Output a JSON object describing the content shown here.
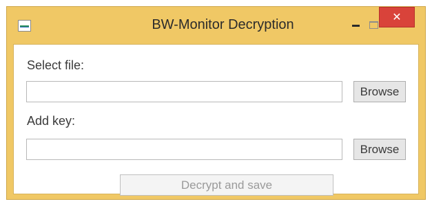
{
  "window": {
    "title": "BW-Monitor Decryption",
    "controls": {
      "minimize": "−",
      "close": "✕"
    }
  },
  "form": {
    "file_label": "Select file:",
    "file_value": "",
    "file_browse": "Browse",
    "key_label": "Add key:",
    "key_value": "",
    "key_browse": "Browse",
    "submit": "Decrypt and save"
  },
  "colors": {
    "frame": "#f0c865",
    "close": "#d9433a"
  }
}
